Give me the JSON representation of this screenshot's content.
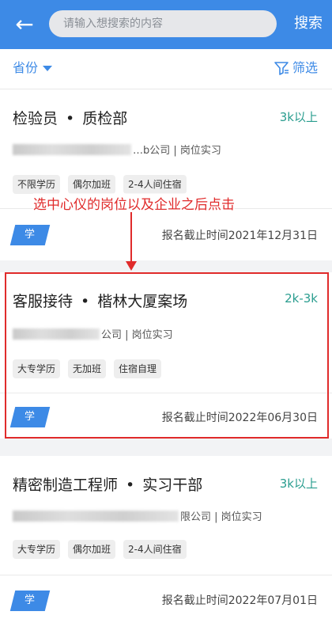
{
  "header": {
    "search_placeholder": "请输入想搜索的内容",
    "search_label": "搜索"
  },
  "filterbar": {
    "province_label": "省份",
    "filter_label": "筛选"
  },
  "annotation": "选中心仪的岗位以及企业之后点击",
  "jobs": [
    {
      "title": "检验员",
      "dot": "•",
      "dept": "质检部",
      "salary": "3k以上",
      "company_suffix": "…b公司 | 岗位实习",
      "tags": [
        "不限学历",
        "偶尔加班",
        "2-4人间住宿"
      ],
      "badge": "学",
      "deadline": "报名截止时间2021年12月31日"
    },
    {
      "title": "客服接待",
      "dot": "•",
      "dept": "楷林大厦案场",
      "salary": "2k-3k",
      "company_suffix": "公司 | 岗位实习",
      "tags": [
        "大专学历",
        "无加班",
        "住宿自理"
      ],
      "badge": "学",
      "deadline": "报名截止时间2022年06月30日"
    },
    {
      "title": "精密制造工程师",
      "dot": "•",
      "dept": "实习干部",
      "salary": "3k以上",
      "company_suffix": "限公司 | 岗位实习",
      "tags": [
        "大专学历",
        "偶尔加班",
        "2-4人间住宿"
      ],
      "badge": "学",
      "deadline": "报名截止时间2022年07月01日"
    }
  ]
}
